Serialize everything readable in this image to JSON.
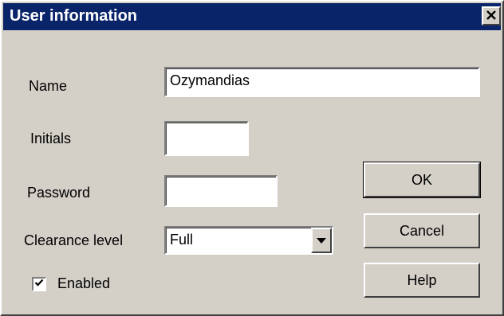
{
  "window": {
    "title": "User information",
    "close_glyph": "×"
  },
  "form": {
    "name_label": "Name",
    "name_value": "Ozymandias",
    "initials_label": "Initials",
    "initials_value": "",
    "password_label": "Password",
    "password_value": "",
    "clearance_label": "Clearance level",
    "clearance_value": "Full",
    "enabled_label": "Enabled",
    "enabled_checked": true
  },
  "buttons": {
    "ok": "OK",
    "cancel": "Cancel",
    "help": "Help"
  },
  "icons": {
    "close": "close-icon",
    "dropdown": "chevron-down-icon",
    "check": "check-icon"
  }
}
